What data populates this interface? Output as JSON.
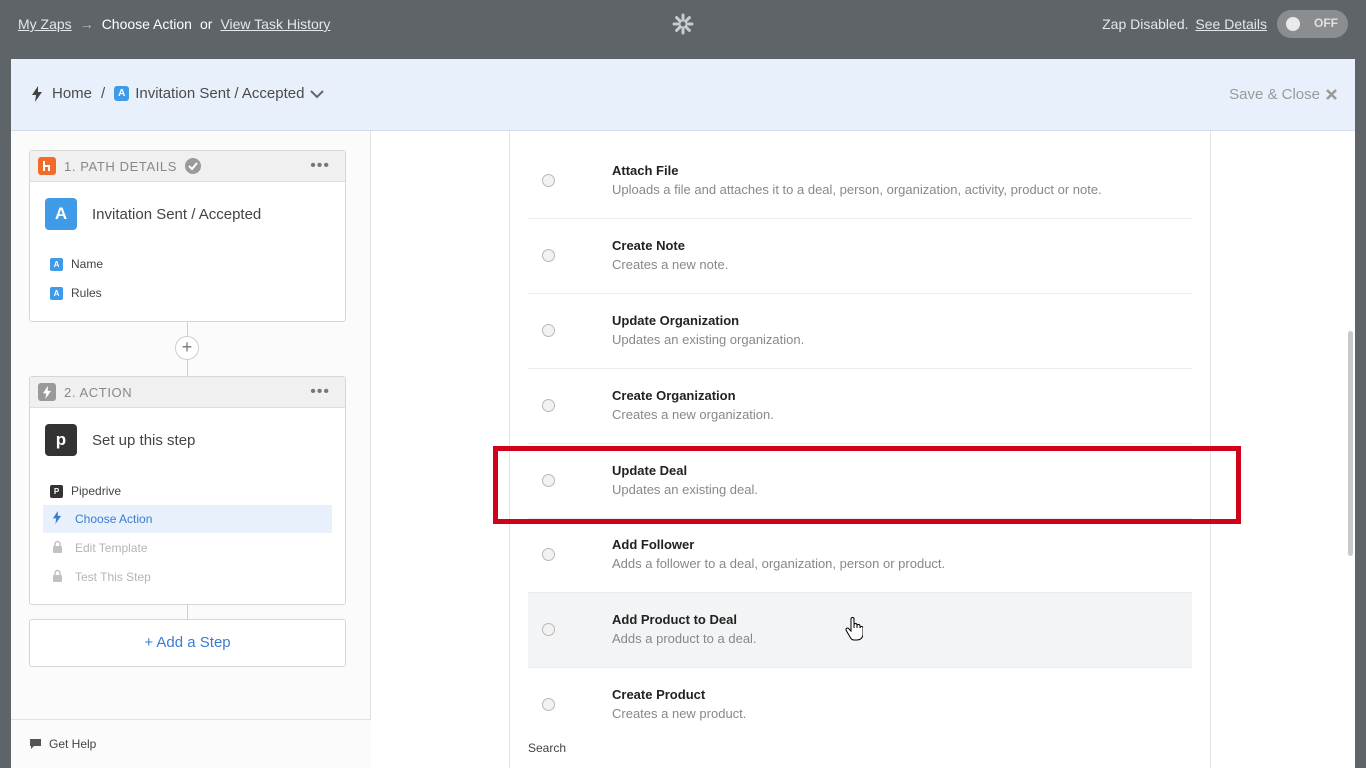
{
  "topbar": {
    "my_zaps": "My Zaps",
    "arrow": "→",
    "current": "Choose Action",
    "or": "or",
    "task_history": "View Task History",
    "status": "Zap Disabled.",
    "see_details": "See Details",
    "toggle_label": "OFF"
  },
  "panel_header": {
    "home": "Home",
    "separator": "/",
    "path_badge": "A",
    "path_name": "Invitation Sent / Accepted",
    "save_close": "Save & Close"
  },
  "sidebar": {
    "step1": {
      "label": "1. PATH DETAILS",
      "icon_letter": "A",
      "title": "Invitation Sent / Accepted",
      "items": [
        {
          "badge": "A",
          "label": "Name"
        },
        {
          "badge": "A",
          "label": "Rules"
        }
      ]
    },
    "step2": {
      "label": "2. ACTION",
      "icon_letter": "p",
      "title": "Set up this step",
      "app_badge": "P",
      "app": "Pipedrive",
      "actions": [
        {
          "label": "Choose Action",
          "state": "selected"
        },
        {
          "label": "Edit Template",
          "state": "locked"
        },
        {
          "label": "Test This Step",
          "state": "locked"
        }
      ]
    },
    "add_step": "+ Add a Step",
    "get_help": "Get Help"
  },
  "action_list": {
    "items": [
      {
        "title": "Attach File",
        "desc": "Uploads a file and attaches it to a deal, person, organization, activity, product or note."
      },
      {
        "title": "Create Note",
        "desc": "Creates a new note."
      },
      {
        "title": "Update Organization",
        "desc": "Updates an existing organization."
      },
      {
        "title": "Create Organization",
        "desc": "Creates a new organization."
      },
      {
        "title": "Update Deal",
        "desc": "Updates an existing deal."
      },
      {
        "title": "Add Follower",
        "desc": "Adds a follower to a deal, organization, person or product."
      },
      {
        "title": "Add Product to Deal",
        "desc": "Adds a product to a deal."
      },
      {
        "title": "Create Product",
        "desc": "Creates a new product."
      }
    ],
    "search_label": "Search",
    "highlighted_item": "Update Deal",
    "hovered_item": "Add Product to Deal"
  },
  "colors": {
    "topbar": "#5f6468",
    "accent": "#3a7bd5",
    "highlight_box": "#d0021b",
    "path_orange": "#f26b2a",
    "pipedrive_dark": "#333333"
  }
}
